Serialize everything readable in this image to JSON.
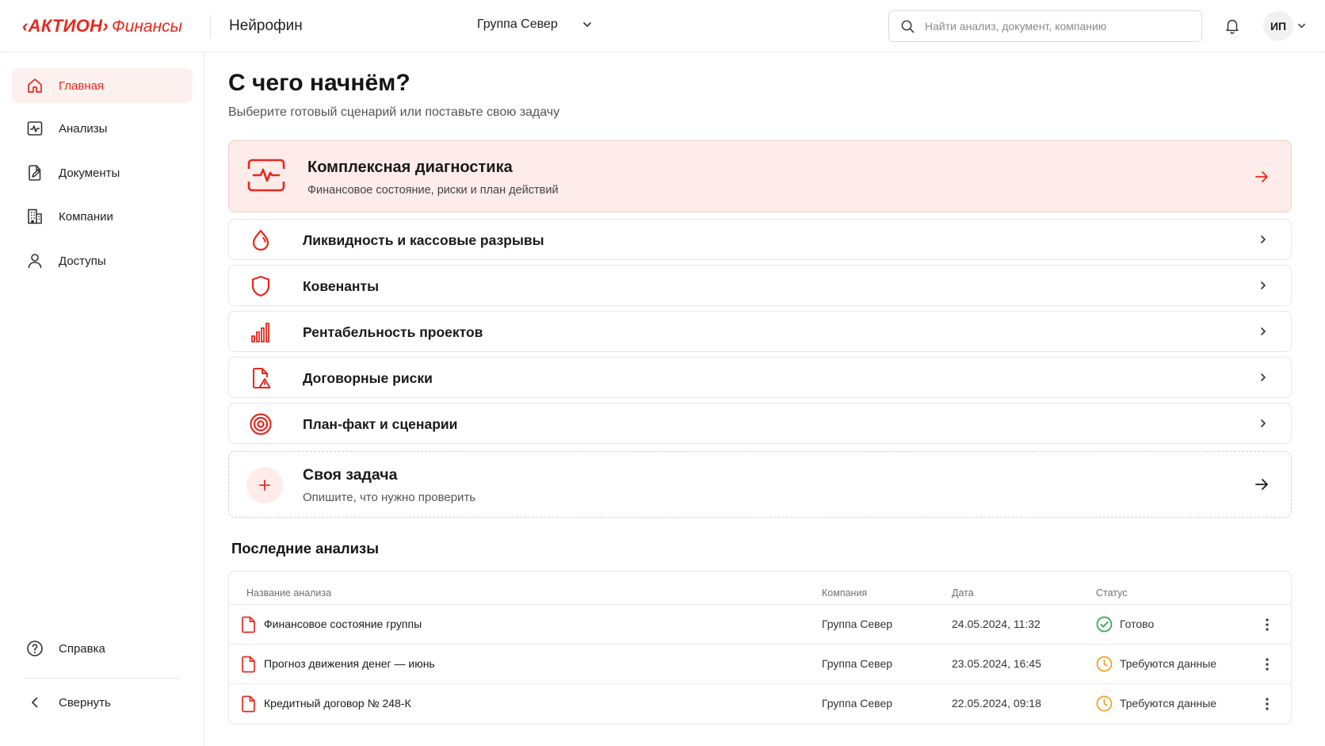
{
  "header": {
    "logo_brand": "‹АКТИОН›",
    "logo_sub": "Финансы",
    "product_name": "Нейрофин",
    "company_selected": "Группа Север",
    "search_placeholder": "Найти анализ, документ, компанию",
    "user_initials": "ИП"
  },
  "sidebar": {
    "items": [
      {
        "label": "Главная",
        "icon": "home-icon",
        "active": true
      },
      {
        "label": "Анализы",
        "icon": "analytics-icon"
      },
      {
        "label": "Документы",
        "icon": "document-edit-icon"
      },
      {
        "label": "Компании",
        "icon": "building-icon"
      },
      {
        "label": "Доступы",
        "icon": "user-icon"
      }
    ],
    "help_label": "Справка",
    "collapse_label": "Свернуть"
  },
  "main": {
    "title": "С чего начнём?",
    "subtitle": "Выберите готовый сценарий или поставьте свою задачу",
    "featured": {
      "title": "Комплексная диагностика",
      "subtitle": "Финансовое состояние, риски и план действий"
    },
    "scenarios": [
      {
        "label": "Ликвидность и кассовые разрывы",
        "icon": "drop-icon"
      },
      {
        "label": "Ковенанты",
        "icon": "shield-icon"
      },
      {
        "label": "Рентабельность проектов",
        "icon": "bar-chart-icon"
      },
      {
        "label": "Договорные риски",
        "icon": "file-warning-icon"
      },
      {
        "label": "План-факт и сценарии",
        "icon": "target-icon"
      }
    ],
    "custom_task": {
      "title": "Своя задача",
      "subtitle": "Опишите, что нужно проверить"
    },
    "recent": {
      "title": "Последние анализы",
      "columns": [
        "Название анализа",
        "Компания",
        "Дата",
        "Статус"
      ],
      "rows": [
        {
          "name": "Финансовое состояние группы",
          "company": "Группа Север",
          "date": "24.05.2024, 11:32",
          "status": "Готово",
          "status_type": "done"
        },
        {
          "name": "Прогноз движения денег — июнь",
          "company": "Группа Север",
          "date": "23.05.2024, 16:45",
          "status": "Требуются данные",
          "status_type": "pending"
        },
        {
          "name": "Кредитный договор № 248-К",
          "company": "Группа Север",
          "date": "22.05.2024, 09:18",
          "status": "Требуются данные",
          "status_type": "pending"
        }
      ]
    }
  },
  "colors": {
    "accent": "#e8281e",
    "featured_bg": "#fdece9",
    "done": "#2fa84f",
    "pending": "#f0a020"
  }
}
